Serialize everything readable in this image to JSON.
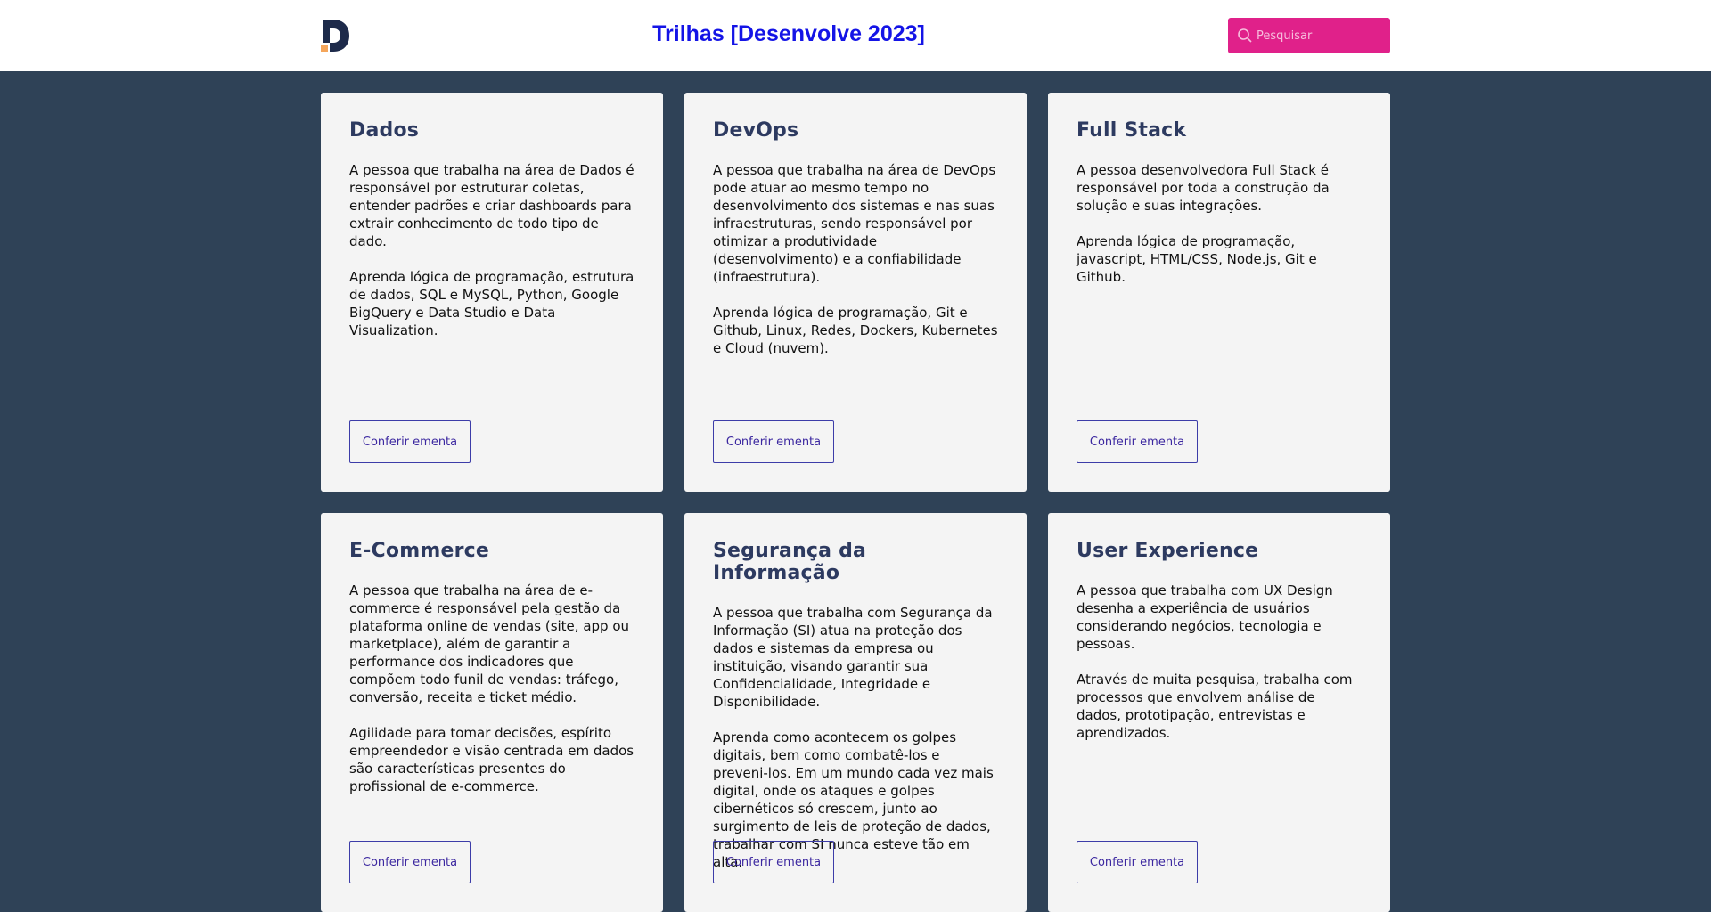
{
  "header": {
    "logo": "desenvolve-logo",
    "title": "Trilhas [Desenvolve 2023]",
    "search_placeholder": "Pesquisar"
  },
  "colors": {
    "header_bg": "#ffffff",
    "page_bg": "#2f4257",
    "title": "#1414e6",
    "search_bg": "#e0218a",
    "card_bg": "#f4f4f4",
    "card_title": "#2d3a60",
    "button_border": "#3c3ca8"
  },
  "cards": [
    {
      "title": "Dados",
      "text": "A pessoa que trabalha na área de Dados é responsável por estruturar coletas, entender padrões e criar dashboards para extrair conhecimento de todo tipo de dado.\n\nAprenda lógica de programação, estrutura de dados, SQL e MySQL, Python, Google BigQuery e Data Studio e Data Visualization.",
      "button": "Conferir ementa"
    },
    {
      "title": "DevOps",
      "text": "A pessoa que trabalha na área de DevOps pode atuar ao mesmo tempo no desenvolvimento dos sistemas e nas suas infraestruturas, sendo responsável por otimizar a produtividade (desenvolvimento) e a confiabilidade (infraestrutura).\n\nAprenda lógica de programação, Git e Github, Linux, Redes, Dockers, Kubernetes e Cloud (nuvem).",
      "button": "Conferir ementa"
    },
    {
      "title": "Full Stack",
      "text": "A pessoa desenvolvedora Full Stack é responsável por toda a construção da solução e suas integrações.\n\nAprenda lógica de programação, javascript, HTML/CSS, Node.js, Git e Github.",
      "button": "Conferir ementa"
    },
    {
      "title": "E-Commerce",
      "text": "A pessoa que trabalha na área de e-commerce é responsável pela gestão da plataforma online de vendas (site, app ou marketplace), além de garantir a performance dos indicadores que compõem todo funil de vendas: tráfego, conversão, receita e ticket médio.\n\nAgilidade para tomar decisões, espírito empreendedor e visão centrada em dados são características presentes do profissional de e-commerce.",
      "button": "Conferir ementa"
    },
    {
      "title": "Segurança da Informação",
      "text": "A pessoa que trabalha com Segurança da Informação (SI) atua na proteção dos dados e sistemas da empresa ou instituição, visando garantir sua Confidencialidade, Integridade e Disponibilidade.\n\nAprenda como acontecem os golpes digitais, bem como combatê-los e preveni-los. Em um mundo cada vez mais digital, onde os ataques e golpes cibernéticos só crescem, junto ao surgimento de leis de proteção de dados, trabalhar com SI nunca esteve tão em alta.",
      "button": "Conferir ementa"
    },
    {
      "title": "User Experience",
      "text": "A pessoa que trabalha com UX Design desenha a experiência de usuários considerando negócios, tecnologia e pessoas.\n\nAtravés de muita pesquisa, trabalha com processos que envolvem análise de dados, prototipação, entrevistas e aprendizados.",
      "button": "Conferir ementa"
    }
  ]
}
